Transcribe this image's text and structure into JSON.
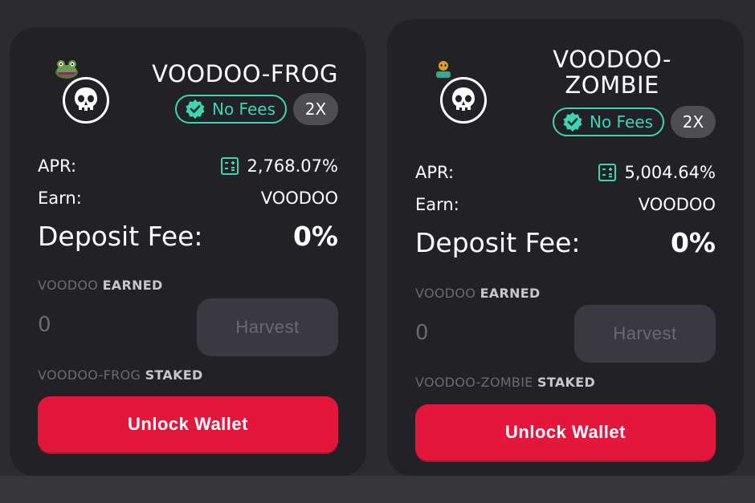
{
  "farms": [
    {
      "title": "VOODOO-FROG",
      "title_line2": "",
      "no_fees_label": "No Fees",
      "multiplier": "2X",
      "apr_label": "APR:",
      "apr_value": "2,768.07%",
      "earn_label": "Earn:",
      "earn_value": "VOODOO",
      "deposit_fee_label": "Deposit Fee:",
      "deposit_fee_value": "0%",
      "earned_token": "VOODOO",
      "earned_suffix": "EARNED",
      "earned_amount": "0",
      "harvest_label": "Harvest",
      "staked_token": "VOODOO-FROG",
      "staked_suffix": "STAKED",
      "unlock_label": "Unlock Wallet",
      "token_icon": "frog-icon"
    },
    {
      "title": "VOODOO-",
      "title_line2": "ZOMBIE",
      "no_fees_label": "No Fees",
      "multiplier": "2X",
      "apr_label": "APR:",
      "apr_value": "5,004.64%",
      "earn_label": "Earn:",
      "earn_value": "VOODOO",
      "deposit_fee_label": "Deposit Fee:",
      "deposit_fee_value": "0%",
      "earned_token": "VOODOO",
      "earned_suffix": "EARNED",
      "earned_amount": "0",
      "harvest_label": "Harvest",
      "staked_token": "VOODOO-ZOMBIE",
      "staked_suffix": "STAKED",
      "unlock_label": "Unlock Wallet",
      "token_icon": "zombie-icon"
    }
  ],
  "colors": {
    "accent_teal": "#3ed5b5",
    "unlock_red": "#e3173c",
    "card_bg": "#222126",
    "page_bg": "#2c2b30"
  }
}
